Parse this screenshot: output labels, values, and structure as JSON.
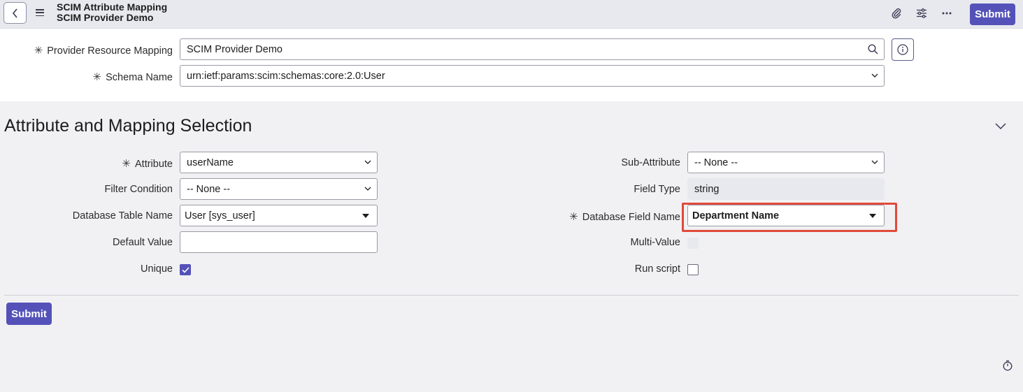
{
  "header": {
    "title": "SCIM Attribute Mapping",
    "subtitle": "SCIM Provider Demo",
    "submit_label": "Submit"
  },
  "top_form": {
    "provider_resource_mapping": {
      "label": "Provider Resource Mapping",
      "value": "SCIM Provider Demo",
      "required": true
    },
    "schema_name": {
      "label": "Schema Name",
      "value": "urn:ietf:params:scim:schemas:core:2.0:User",
      "required": true
    }
  },
  "section": {
    "title": "Attribute and Mapping Selection"
  },
  "left_fields": {
    "attribute": {
      "label": "Attribute",
      "value": "userName",
      "required": true
    },
    "filter_condition": {
      "label": "Filter Condition",
      "value": "-- None --"
    },
    "database_table_name": {
      "label": "Database Table Name",
      "value": "User [sys_user]"
    },
    "default_value": {
      "label": "Default Value",
      "value": ""
    },
    "unique": {
      "label": "Unique",
      "checked": true
    }
  },
  "right_fields": {
    "sub_attribute": {
      "label": "Sub-Attribute",
      "value": "-- None --"
    },
    "field_type": {
      "label": "Field Type",
      "value": "string"
    },
    "database_field_name": {
      "label": "Database Field Name",
      "value": "Department Name",
      "required": true
    },
    "multi_value": {
      "label": "Multi-Value",
      "checked": false
    },
    "run_script": {
      "label": "Run script",
      "checked": false
    }
  },
  "footer": {
    "submit_label": "Submit"
  },
  "colors": {
    "accent": "#5452b9",
    "highlight": "#e04a3a"
  },
  "icons": [
    "back-icon",
    "menu-icon",
    "attachment-icon",
    "settings-sliders-icon",
    "more-icon",
    "search-icon",
    "info-icon",
    "chevron-down-icon",
    "timer-icon"
  ]
}
